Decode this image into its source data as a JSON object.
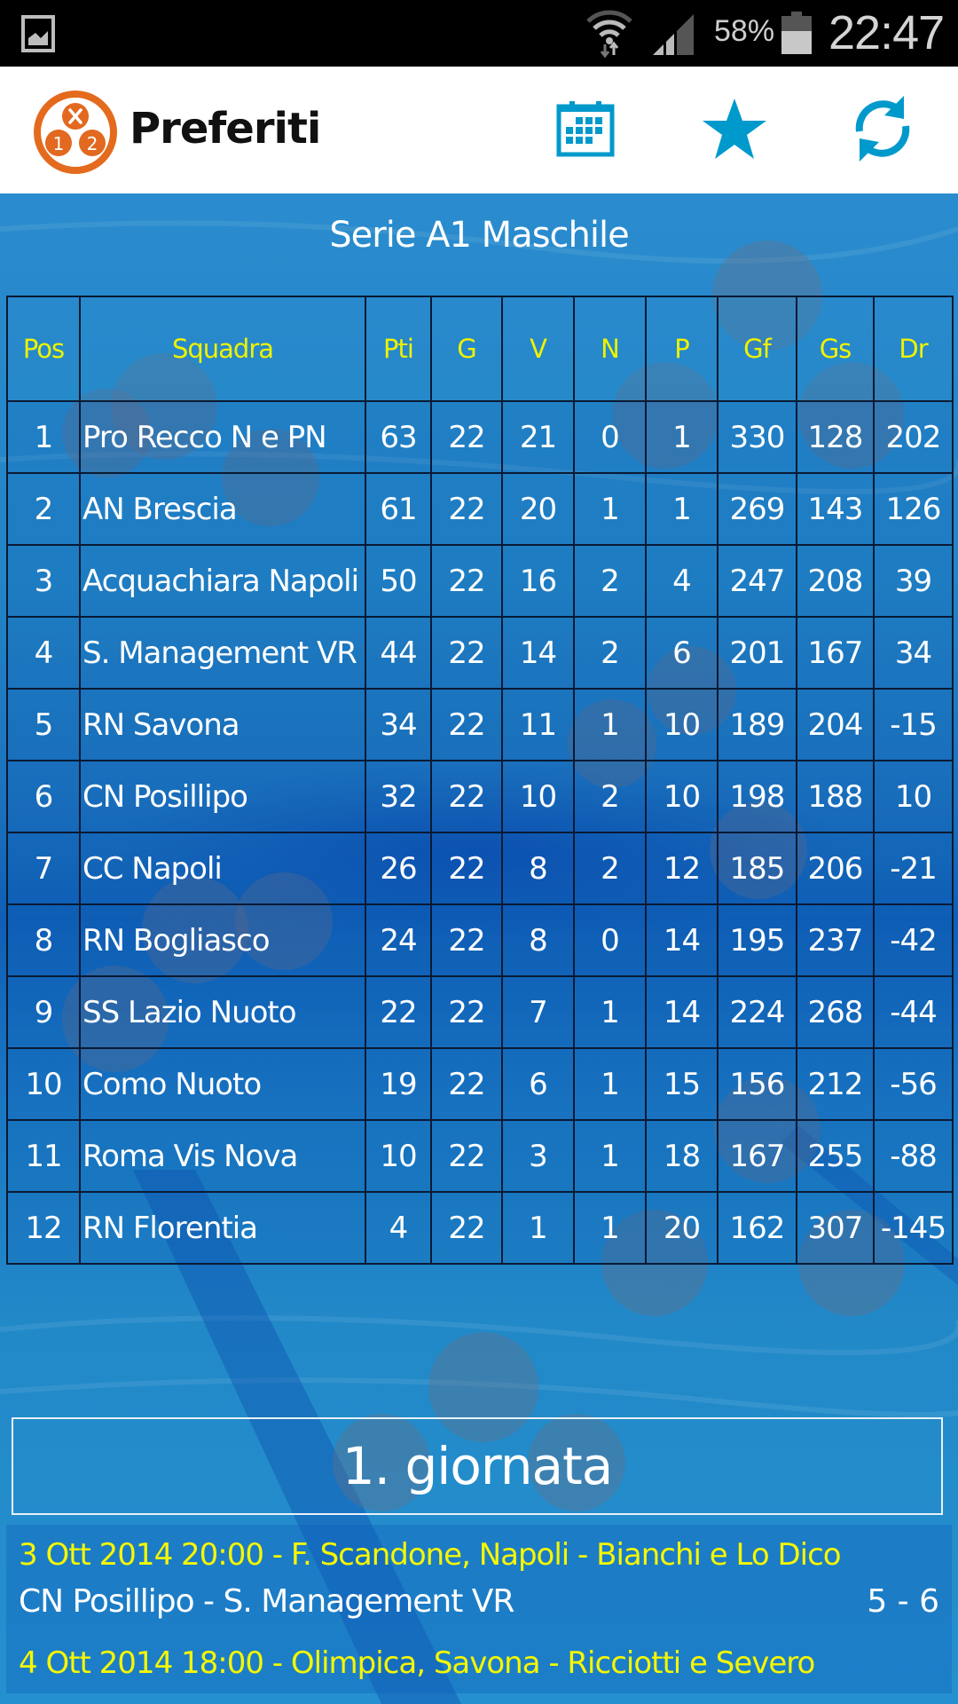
{
  "status_bar": {
    "battery_percent": "58%",
    "time": "22:47",
    "icons": [
      "gallery-notification-icon",
      "wifi-icon",
      "signal-icon",
      "battery-icon"
    ]
  },
  "app_bar": {
    "title": "Preferiti",
    "logo": "1x2-logo",
    "actions": [
      {
        "name": "calendar",
        "icon": "calendar-icon"
      },
      {
        "name": "favorites",
        "icon": "star-icon"
      },
      {
        "name": "refresh",
        "icon": "refresh-icon"
      }
    ],
    "accent_color": "#0099cc"
  },
  "league": {
    "title": "Serie A1 Maschile"
  },
  "standings": {
    "columns": [
      "Pos",
      "Squadra",
      "Pti",
      "G",
      "V",
      "N",
      "P",
      "Gf",
      "Gs",
      "Dr"
    ],
    "rows": [
      [
        "1",
        "Pro Recco N e PN",
        "63",
        "22",
        "21",
        "0",
        "1",
        "330",
        "128",
        "202"
      ],
      [
        "2",
        "AN Brescia",
        "61",
        "22",
        "20",
        "1",
        "1",
        "269",
        "143",
        "126"
      ],
      [
        "3",
        "Acquachiara Napoli",
        "50",
        "22",
        "16",
        "2",
        "4",
        "247",
        "208",
        "39"
      ],
      [
        "4",
        "S. Management VR",
        "44",
        "22",
        "14",
        "2",
        "6",
        "201",
        "167",
        "34"
      ],
      [
        "5",
        "RN Savona",
        "34",
        "22",
        "11",
        "1",
        "10",
        "189",
        "204",
        "-15"
      ],
      [
        "6",
        "CN Posillipo",
        "32",
        "22",
        "10",
        "2",
        "10",
        "198",
        "188",
        "10"
      ],
      [
        "7",
        "CC Napoli",
        "26",
        "22",
        "8",
        "2",
        "12",
        "185",
        "206",
        "-21"
      ],
      [
        "8",
        "RN Bogliasco",
        "24",
        "22",
        "8",
        "0",
        "14",
        "195",
        "237",
        "-42"
      ],
      [
        "9",
        "SS Lazio Nuoto",
        "22",
        "22",
        "7",
        "1",
        "14",
        "224",
        "268",
        "-44"
      ],
      [
        "10",
        "Como Nuoto",
        "19",
        "22",
        "6",
        "1",
        "15",
        "156",
        "212",
        "-56"
      ],
      [
        "11",
        "Roma Vis Nova",
        "10",
        "22",
        "3",
        "1",
        "18",
        "167",
        "255",
        "-88"
      ],
      [
        "12",
        "RN Florentia",
        "4",
        "22",
        "1",
        "1",
        "20",
        "162",
        "307",
        "-145"
      ]
    ]
  },
  "round": {
    "title": "1. giornata",
    "matches": [
      {
        "info": "3 Ott 2014 20:00 - F. Scandone, Napoli - Bianchi e Lo Dico",
        "teams": "CN Posillipo - S. Management VR",
        "score": "5 - 6"
      },
      {
        "info": "4 Ott 2014 18:00 - Olimpica, Savona - Ricciotti e Severo",
        "teams": "",
        "score": ""
      }
    ]
  }
}
